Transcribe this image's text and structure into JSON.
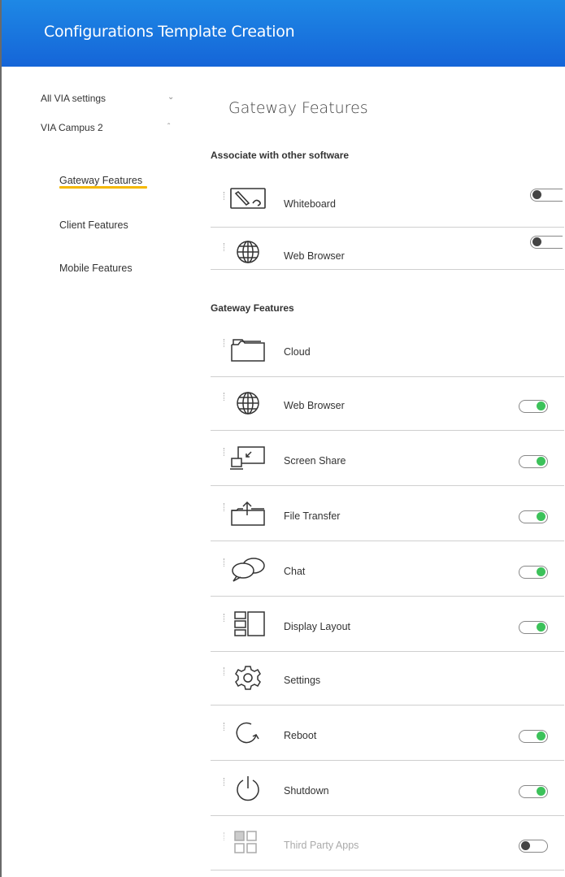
{
  "app": {
    "title": "Configurations Template Creation"
  },
  "sidebar": {
    "groups": [
      {
        "label": "All VIA settings",
        "chevron": "chevron-down-icon"
      },
      {
        "label": "VIA Campus 2",
        "chevron": "chevron-up-icon"
      }
    ],
    "items": [
      {
        "label": "Gateway Features",
        "active": true
      },
      {
        "label": "Client Features"
      },
      {
        "label": "Mobile Features"
      }
    ]
  },
  "main": {
    "page_title": "Gateway Features",
    "associate_section": {
      "title": "Associate with other software",
      "rows": [
        {
          "label": "Whiteboard",
          "icon": "whiteboard-icon",
          "toggle": "off"
        },
        {
          "label": "Web Browser",
          "icon": "globe-icon",
          "toggle": "off"
        }
      ]
    },
    "gateway_section": {
      "title": "Gateway Features",
      "rows": [
        {
          "label": "Cloud",
          "icon": "folder-icon",
          "toggle": null
        },
        {
          "label": "Web Browser",
          "icon": "globe-icon",
          "toggle": "on"
        },
        {
          "label": "Screen Share",
          "icon": "screen-share-icon",
          "toggle": "on"
        },
        {
          "label": "File Transfer",
          "icon": "file-transfer-icon",
          "toggle": "on"
        },
        {
          "label": "Chat",
          "icon": "chat-icon",
          "toggle": "on"
        },
        {
          "label": "Display Layout",
          "icon": "display-layout-icon",
          "toggle": "on"
        },
        {
          "label": "Settings",
          "icon": "gear-icon",
          "toggle": null
        },
        {
          "label": "Reboot",
          "icon": "reboot-icon",
          "toggle": "on"
        },
        {
          "label": "Shutdown",
          "icon": "power-icon",
          "toggle": "on"
        },
        {
          "label": "Third Party Apps",
          "icon": "apps-grid-icon",
          "toggle": "off",
          "disabled": true
        }
      ]
    }
  },
  "colors": {
    "header": "#1e88e5",
    "accent_underline": "#f5b800",
    "toggle_on": "#3cc25a"
  }
}
